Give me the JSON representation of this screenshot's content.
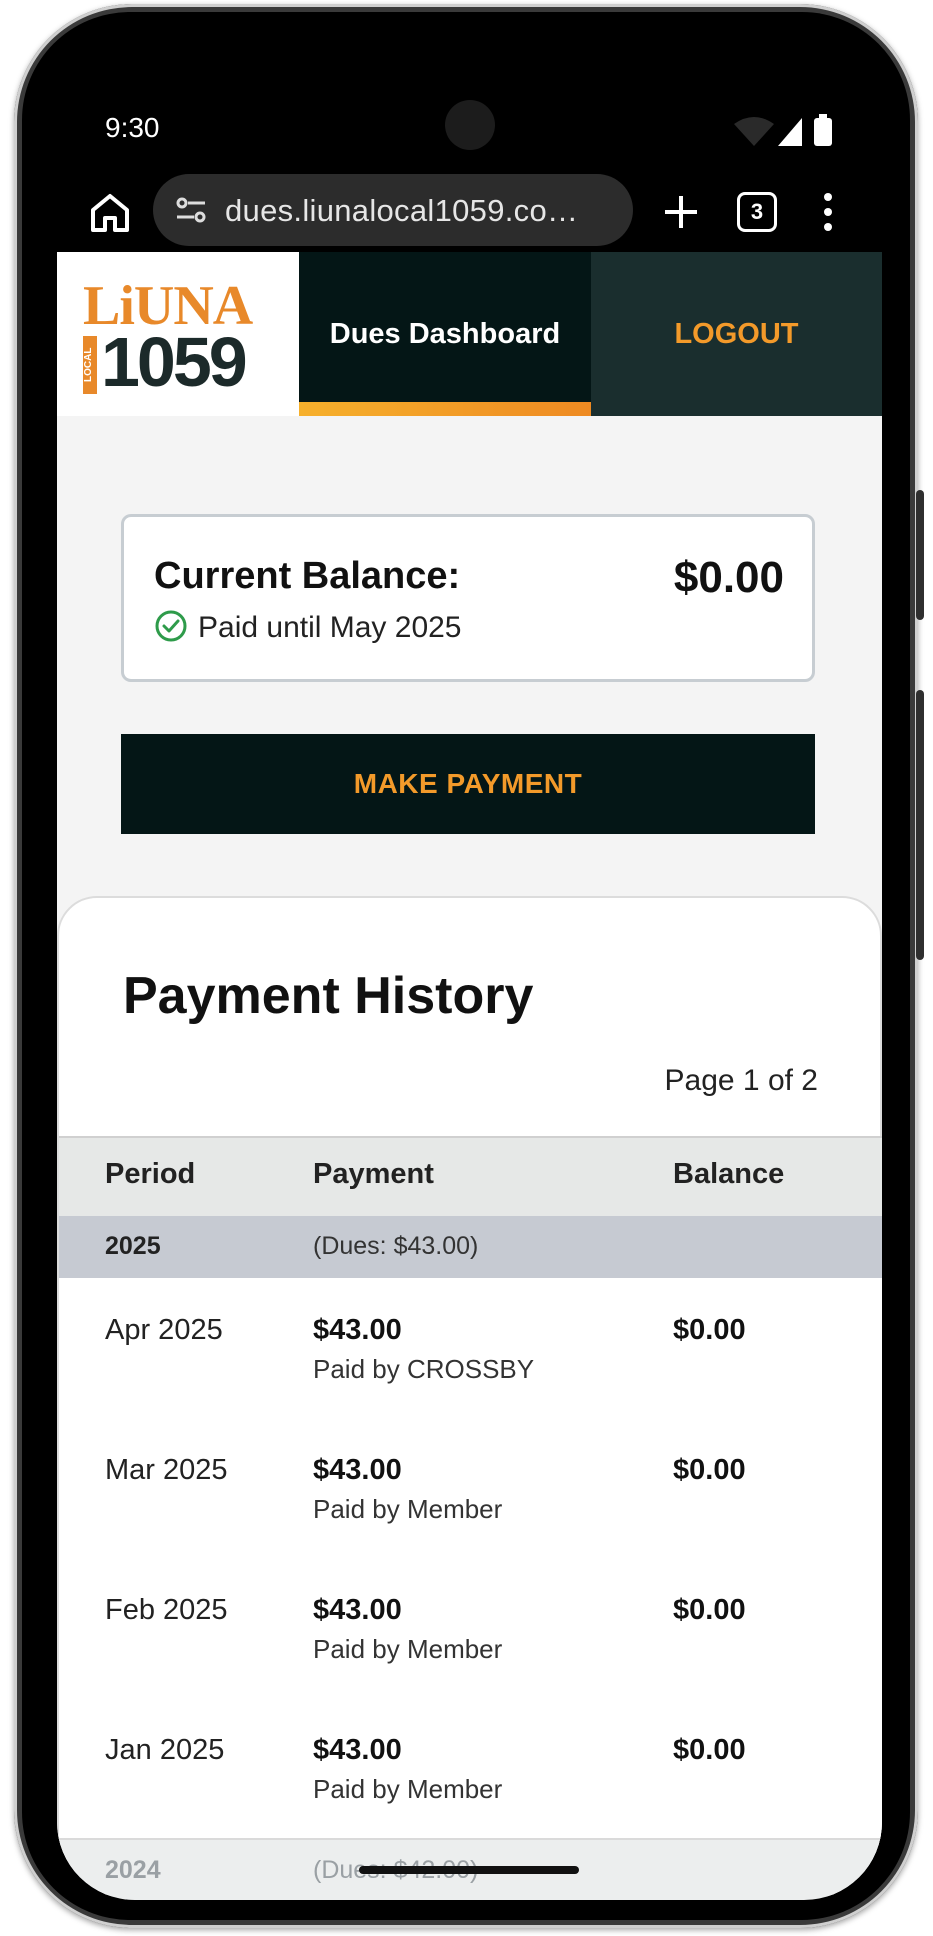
{
  "status_bar": {
    "time": "9:30"
  },
  "browser": {
    "url": "dues.liunalocal1059.co…",
    "tab_count": "3"
  },
  "header": {
    "logo_top": "LiUNA",
    "logo_local": "LOCAL",
    "logo_number": "1059",
    "nav_dashboard": "Dues Dashboard",
    "nav_logout": "LOGOUT"
  },
  "balance": {
    "label": "Current Balance:",
    "amount": "$0.00",
    "status": "Paid until May 2025"
  },
  "actions": {
    "make_payment": "MAKE PAYMENT"
  },
  "history": {
    "title": "Payment History",
    "page_indicator": "Page 1 of 2",
    "columns": [
      "Period",
      "Payment",
      "Balance"
    ],
    "years": [
      {
        "year": "2025",
        "dues": "(Dues: $43.00)",
        "rows": [
          {
            "period": "Apr 2025",
            "amount": "$43.00",
            "payer": "Paid by CROSSBY",
            "balance": "$0.00"
          },
          {
            "period": "Mar 2025",
            "amount": "$43.00",
            "payer": "Paid by Member",
            "balance": "$0.00"
          },
          {
            "period": "Feb 2025",
            "amount": "$43.00",
            "payer": "Paid by Member",
            "balance": "$0.00"
          },
          {
            "period": "Jan 2025",
            "amount": "$43.00",
            "payer": "Paid by Member",
            "balance": "$0.00"
          }
        ]
      },
      {
        "year": "2024",
        "dues": "(Dues: $42.00)",
        "rows": []
      }
    ]
  },
  "colors": {
    "brand_orange": "#f39a2a",
    "brand_dark": "#041616",
    "paid_green": "#2e9b4a"
  }
}
